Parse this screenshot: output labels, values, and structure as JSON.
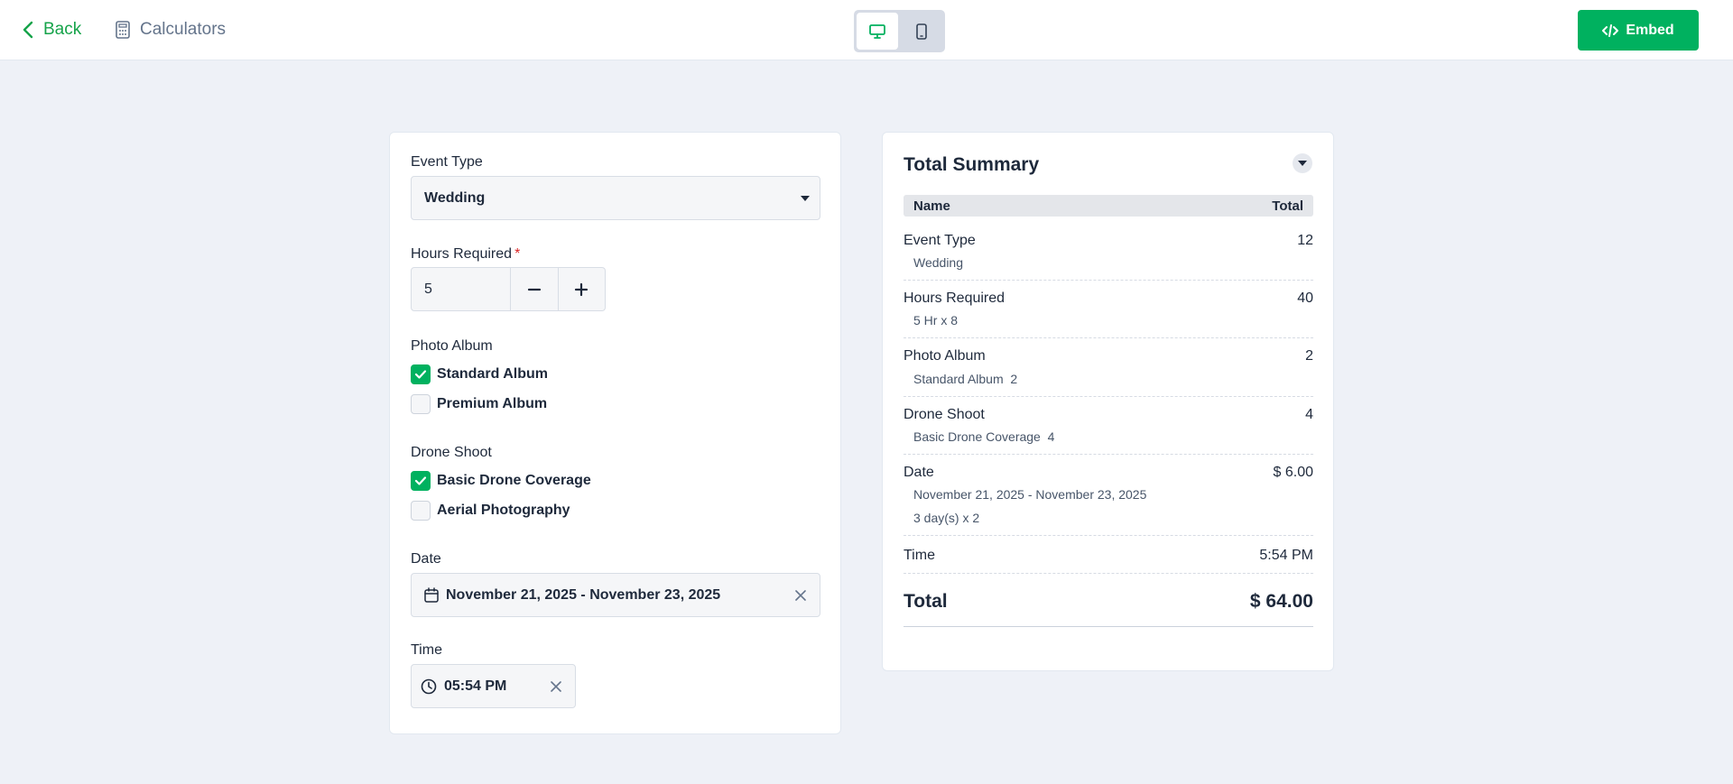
{
  "header": {
    "back_label": "Back",
    "breadcrumb_label": "Calculators",
    "embed_label": "Embed"
  },
  "colors": {
    "accent": "#00b15f",
    "background": "#eef1f7"
  },
  "form": {
    "event_type": {
      "label": "Event Type",
      "value": "Wedding"
    },
    "hours": {
      "label": "Hours Required",
      "required_mark": "*",
      "value": "5"
    },
    "photo_album": {
      "label": "Photo Album",
      "options": [
        {
          "label": "Standard Album",
          "checked": true
        },
        {
          "label": "Premium Album",
          "checked": false
        }
      ]
    },
    "drone_shoot": {
      "label": "Drone Shoot",
      "options": [
        {
          "label": "Basic Drone Coverage",
          "checked": true
        },
        {
          "label": "Aerial Photography",
          "checked": false
        }
      ]
    },
    "date": {
      "label": "Date",
      "value": "November 21, 2025 - November 23, 2025"
    },
    "time": {
      "label": "Time",
      "value": "05:54 PM"
    }
  },
  "summary": {
    "title": "Total Summary",
    "col_name": "Name",
    "col_total": "Total",
    "rows": [
      {
        "name": "Event Type",
        "value": "12",
        "subs": [
          "Wedding"
        ]
      },
      {
        "name": "Hours Required",
        "value": "40",
        "subs": [
          "5 Hr x 8"
        ]
      },
      {
        "name": "Photo Album",
        "value": "2",
        "subs": [
          "Standard Album  2"
        ]
      },
      {
        "name": "Drone Shoot",
        "value": "4",
        "subs": [
          "Basic Drone Coverage  4"
        ]
      },
      {
        "name": "Date",
        "value": "$ 6.00",
        "subs": [
          "November 21, 2025 - November 23, 2025",
          "3 day(s) x 2"
        ]
      },
      {
        "name": "Time",
        "value": "5:54 PM",
        "subs": []
      }
    ],
    "total_label": "Total",
    "total_value": "$ 64.00"
  }
}
